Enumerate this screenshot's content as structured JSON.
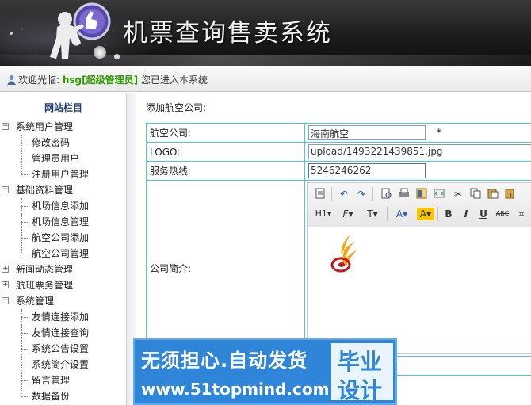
{
  "header": {
    "title": "机票查询售卖系统",
    "logo_icon": "touchscreen-figure-logo-icon"
  },
  "welcome": {
    "prefix": "欢迎光临:",
    "username": "hsg[超级管理员]",
    "suffix": "您已进入本系统",
    "icon": "user-icon"
  },
  "sidebar": {
    "title": "网站栏目",
    "groups": [
      {
        "label": "系统用户管理",
        "expanded": true,
        "items": [
          "修改密码",
          "管理员用户",
          "注册用户管理"
        ]
      },
      {
        "label": "基础资料管理",
        "expanded": true,
        "items": [
          "机场信息添加",
          "机场信息管理",
          "航空公司添加",
          "航空公司管理"
        ]
      },
      {
        "label": "新闻动态管理",
        "expanded": false,
        "items": []
      },
      {
        "label": "航班票务管理",
        "expanded": false,
        "items": []
      },
      {
        "label": "系统管理",
        "expanded": true,
        "items": [
          "友情连接添加",
          "友情连接查询",
          "系统公告设置",
          "系统简介设置",
          "留言管理",
          "数据备份"
        ]
      }
    ]
  },
  "main": {
    "section_title": "添加航空公司:",
    "fields": {
      "airline_label": "航空公司:",
      "airline_value": "海南航空",
      "required_mark": "*",
      "logo_label": "LOGO:",
      "logo_value": "upload/1493221439851.jpg",
      "hotline_label": "服务热线:",
      "hotline_value": "5246246262",
      "intro_label": "公司简介:"
    },
    "editor": {
      "toolbar_row1": [
        "source-icon",
        "undo-icon",
        "redo-icon",
        "preview-icon",
        "print-icon",
        "template-icon",
        "code-icon",
        "cut-icon",
        "copy-icon",
        "paste-icon"
      ],
      "toolbar_row2": {
        "heading": "H1",
        "font": "F",
        "font_size": "T",
        "font_color": "A",
        "highlight": "A",
        "bold": "B",
        "italic": "I",
        "underline": "U",
        "strike": "ABC",
        "table": "⌗"
      },
      "content_image": "hainan-airlines-logo-icon",
      "colors": {
        "highlight_bg": "#f7c500",
        "logo_gold": "#f0a81a",
        "logo_red": "#c4161c"
      }
    }
  },
  "watermark": {
    "line1": "无须担心.自动发货",
    "line2": "www.51topmind.com",
    "box_line1": "毕业",
    "box_line2": "设计"
  }
}
